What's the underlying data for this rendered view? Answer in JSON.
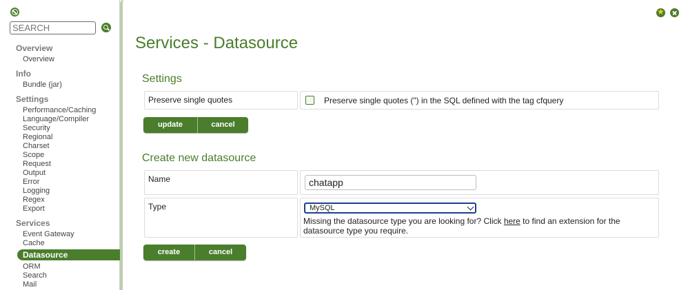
{
  "sidebar": {
    "search_placeholder": "SEARCH",
    "groups": [
      {
        "title": "Overview",
        "items": [
          "Overview"
        ]
      },
      {
        "title": "Info",
        "items": [
          "Bundle (jar)"
        ]
      },
      {
        "title": "Settings",
        "items": [
          "Performance/Caching",
          "Language/Compiler",
          "Security",
          "Regional",
          "Charset",
          "Scope",
          "Request",
          "Output",
          "Error",
          "Logging",
          "Regex",
          "Export"
        ]
      },
      {
        "title": "Services",
        "items": [
          "Event Gateway",
          "Cache",
          "Datasource",
          "ORM",
          "Search",
          "Mail"
        ]
      }
    ]
  },
  "page": {
    "title": "Services - Datasource"
  },
  "settings": {
    "heading": "Settings",
    "label": "Preserve single quotes",
    "checkbox_text": "Preserve single quotes (\") in the SQL defined with the tag cfquery",
    "checked": false,
    "update_label": "update",
    "cancel_label": "cancel"
  },
  "create": {
    "heading": "Create new datasource",
    "name_label": "Name",
    "name_value": "chatapp",
    "type_label": "Type",
    "type_value": "MySQL",
    "help_before": "Missing the datasource type you are looking for? Click ",
    "help_link": "here",
    "help_after": " to find an extension for the datasource type you require.",
    "create_label": "create",
    "cancel_label": "cancel"
  },
  "colors": {
    "accent": "#4a7d2c",
    "frame": "#bccdb0"
  }
}
